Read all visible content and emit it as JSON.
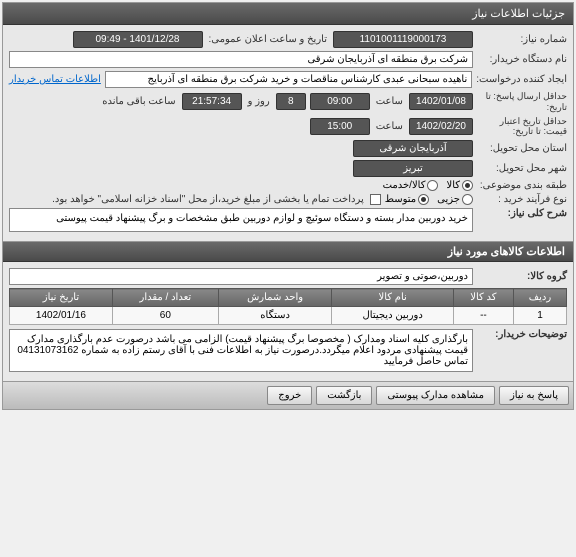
{
  "header": {
    "title": "جزئیات اطلاعات نیاز"
  },
  "fields": {
    "need_number_label": "شماره نیاز:",
    "need_number": "1101001119000173",
    "announce_label": "تاریخ و ساعت اعلان عمومی:",
    "announce_value": "1401/12/28 - 09:49",
    "org_label": "نام دستگاه خریدار:",
    "org_value": "شرکت برق منطقه ای آذربایجان شرقی",
    "requester_label": "ایجاد کننده درخواست:",
    "requester_value": "ناهیده  سبحانی عبدی کارشناس مناقصات و خرید شرکت برق منطقه ای آذربایج",
    "contact_link": "اطلاعات تماس خریدار",
    "deadline_label1": "حداقل ارسال پاسخ: تا",
    "deadline_label2": "تاریخ:",
    "deadline_date": "1402/01/08",
    "time_label": "ساعت",
    "deadline_time": "09:00",
    "days_value": "8",
    "days_label": "روز و",
    "countdown": "21:57:34",
    "remaining_label": "ساعت باقی مانده",
    "validity_label1": "حداقل تاریخ اعتبار",
    "validity_label2": "قیمت: تا تاریخ:",
    "validity_date": "1402/02/20",
    "validity_time": "15:00",
    "province_label": "استان محل تحویل:",
    "province_value": "آذربایجان شرقی",
    "city_label": "شهر محل تحویل:",
    "city_value": "تبریز",
    "category_label": "طبقه بندی موضوعی:",
    "cat_goods": "کالا",
    "cat_service": "کالا/خدمت",
    "process_label": "نوع فرآیند خرید :",
    "proc_small": "جزیی",
    "proc_medium": "متوسط",
    "payment_note": "پرداخت تمام یا بخشی از مبلغ خرید،از محل \"اسناد خزانه اسلامی\" خواهد بود.",
    "summary_label": "شرح کلی نیاز:",
    "summary_value": "خرید دوربین مدار بسته و دستگاه سوئیچ و لوازم دوربین طبق مشخصات و برگ پیشنهاد قیمت پیوستی"
  },
  "items_section": {
    "title": "اطلاعات کالاهای مورد نیاز",
    "group_label": "گروه کالا:",
    "group_value": "دوربین،صوتی و تصویر"
  },
  "table": {
    "headers": {
      "row": "ردیف",
      "code": "کد کالا",
      "name": "نام کالا",
      "unit": "واحد شمارش",
      "qty": "تعداد / مقدار",
      "date": "تاریخ نیاز"
    },
    "rows": [
      {
        "row": "1",
        "code": "--",
        "name": "دوربین دیجیتال",
        "unit": "دستگاه",
        "qty": "60",
        "date": "1402/01/16"
      }
    ]
  },
  "buyer_notes": {
    "label": "توضیحات خریدار:",
    "value": "بارگذاری کلیه اسناد ومدارک ( مخصوصا برگ پیشنهاد قیمت) الزامی می باشد درصورت عدم بارگذاری مدارک قیمت پیشنهادی مردود اعلام میگردد.درصورت نیاز به اطلاعات فنی با آقای رستم زاده به شماره 04131073162 تماس حاصل فرمایید"
  },
  "buttons": {
    "respond": "پاسخ به نیاز",
    "view_docs": "مشاهده مدارک پیوستی",
    "back": "بازگشت",
    "exit": "خروج"
  }
}
